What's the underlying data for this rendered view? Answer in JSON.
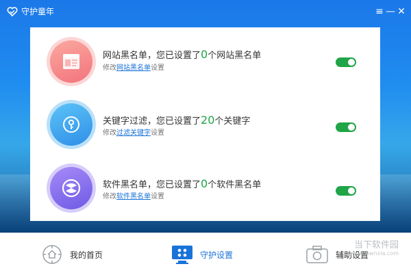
{
  "app": {
    "title": "守护童年"
  },
  "window_controls": [
    "≡",
    "—",
    "✕"
  ],
  "items": [
    {
      "prefix": "网站黑名单，您已设置了",
      "count": "0",
      "suffix": "个网站黑名单",
      "sub_prefix": "修改",
      "sub_link": "网站黑名单",
      "sub_suffix": "设置",
      "icon": "webpage-icon",
      "color": "#f58a8a",
      "enabled": true
    },
    {
      "prefix": "关键字过滤，您已设置了",
      "count": "20",
      "suffix": "个关键字",
      "sub_prefix": "修改",
      "sub_link": "过滤关键字",
      "sub_suffix": "设置",
      "icon": "key-icon",
      "color": "#3aa6ef",
      "enabled": true
    },
    {
      "prefix": "软件黑名单，您已设置了",
      "count": "0",
      "suffix": "个软件黑名单",
      "sub_prefix": "修改",
      "sub_link": "软件黑名单",
      "sub_suffix": "设置",
      "icon": "software-icon",
      "color": "#8a6ff0",
      "enabled": true
    }
  ],
  "nav": [
    {
      "label": "我的首页",
      "icon": "home-icon",
      "active": false
    },
    {
      "label": "守护设置",
      "icon": "monitor-icon",
      "active": true
    },
    {
      "label": "辅助设置",
      "icon": "camera-icon",
      "active": false
    }
  ],
  "watermark": {
    "line1": "当下软件园",
    "line2": "www.downxia.com"
  },
  "colors": {
    "accent": "#1a73d9",
    "count_green": "#1fa547",
    "title_bar": "#1b78e8"
  }
}
